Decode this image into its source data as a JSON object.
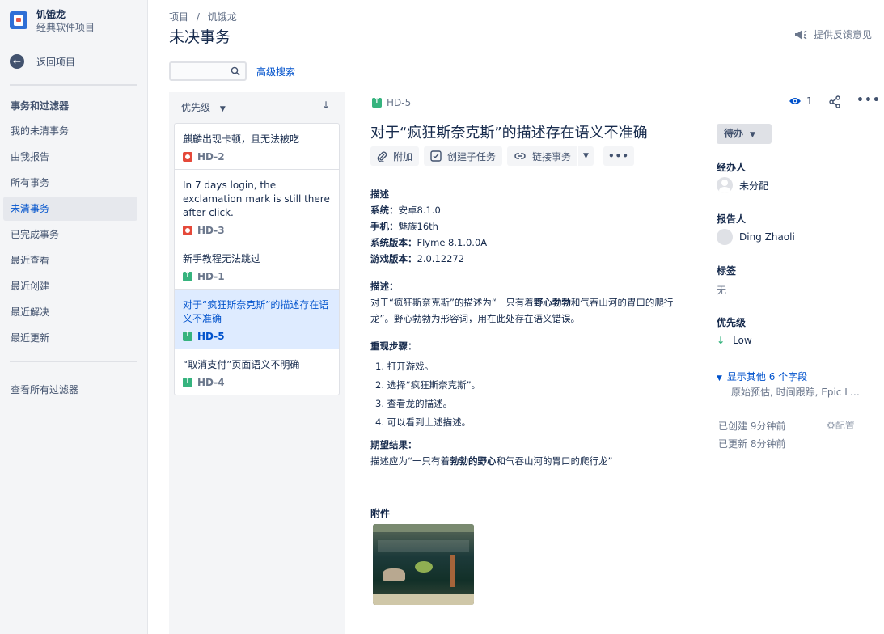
{
  "sidebar": {
    "project_name": "饥饿龙",
    "project_type": "经典软件项目",
    "back_label": "返回项目",
    "section_title": "事务和过滤器",
    "items": [
      {
        "label": "我的未清事务"
      },
      {
        "label": "由我报告"
      },
      {
        "label": "所有事务"
      },
      {
        "label": "未清事务",
        "active": true
      },
      {
        "label": "已完成事务"
      },
      {
        "label": "最近查看"
      },
      {
        "label": "最近创建"
      },
      {
        "label": "最近解决"
      },
      {
        "label": "最近更新"
      }
    ],
    "view_all_filters": "查看所有过滤器"
  },
  "header": {
    "breadcrumbs": [
      "项目",
      "/",
      "饥饿龙"
    ],
    "title": "未决事务",
    "feedback": "提供反馈意见"
  },
  "search": {
    "placeholder": "",
    "value": ""
  },
  "advanced_search": "高级搜索",
  "list": {
    "sort_label": "优先级",
    "sort_direction_icon": "arrow-down",
    "issues": [
      {
        "title": "麒麟出现卡顿，且无法被吃",
        "key": "HD-2",
        "type": "bug"
      },
      {
        "title": "In 7 days login, the exclamation mark is still there after click.",
        "key": "HD-3",
        "type": "bug"
      },
      {
        "title": "新手教程无法跳过",
        "key": "HD-1",
        "type": "improvement"
      },
      {
        "title": "对于“疯狂斯奈克斯”的描述存在语义不准确",
        "key": "HD-5",
        "type": "improvement",
        "active": true
      },
      {
        "title": "“取消支付”页面语义不明确",
        "key": "HD-4",
        "type": "improvement"
      }
    ]
  },
  "detail": {
    "key": "HD-5",
    "title": "对于“疯狂斯奈克斯”的描述存在语义不准确",
    "actions": {
      "attach": "附加",
      "create_subtask": "创建子任务",
      "link_issue": "链接事务"
    },
    "desc_heading": "描述",
    "env": [
      {
        "label": "系统：",
        "value": "安卓8.1.0"
      },
      {
        "label": "手机：",
        "value": "魅族16th"
      },
      {
        "label": "系统版本：",
        "value": "Flyme 8.1.0.0A"
      },
      {
        "label": "游戏版本：",
        "value": "2.0.12272"
      }
    ],
    "desc2_heading": "描述：",
    "desc2_a": "对于“疯狂斯奈克斯”的描述为“一只有着",
    "desc2_b": "野心勃勃",
    "desc2_c": "和气吞山河的胃口的爬行龙”。野心勃勃为形容词，用在此处存在语义错误。",
    "steps_heading": "重现步骤：",
    "steps": [
      "1. 打开游戏。",
      "2. 选择“疯狂斯奈克斯”。",
      "3. 查看龙的描述。",
      "4. 可以看到上述描述。"
    ],
    "expected_heading": "期望结果：",
    "expected_a": "描述应为“一只有着",
    "expected_b": "勃勃的野心",
    "expected_c": "和气吞山河的胃口的爬行龙”",
    "attachments_heading": "附件"
  },
  "right": {
    "watchers": "1",
    "status": "待办",
    "assignee_label": "经办人",
    "assignee": "未分配",
    "reporter_label": "报告人",
    "reporter": "Ding Zhaoli",
    "labels_label": "标签",
    "labels_value": "无",
    "priority_label": "优先级",
    "priority": "Low",
    "more_fields": "显示其他 6 个字段",
    "more_fields_sub": "原始预估, 时间跟踪, Epic Li...",
    "created": "已创建 9分钟前",
    "updated": "已更新 8分钟前",
    "configure": "配置"
  },
  "colors": {
    "accent": "#0052cc",
    "bug": "#e5493a",
    "improvement": "#36b37e",
    "selected": "#deebff"
  }
}
